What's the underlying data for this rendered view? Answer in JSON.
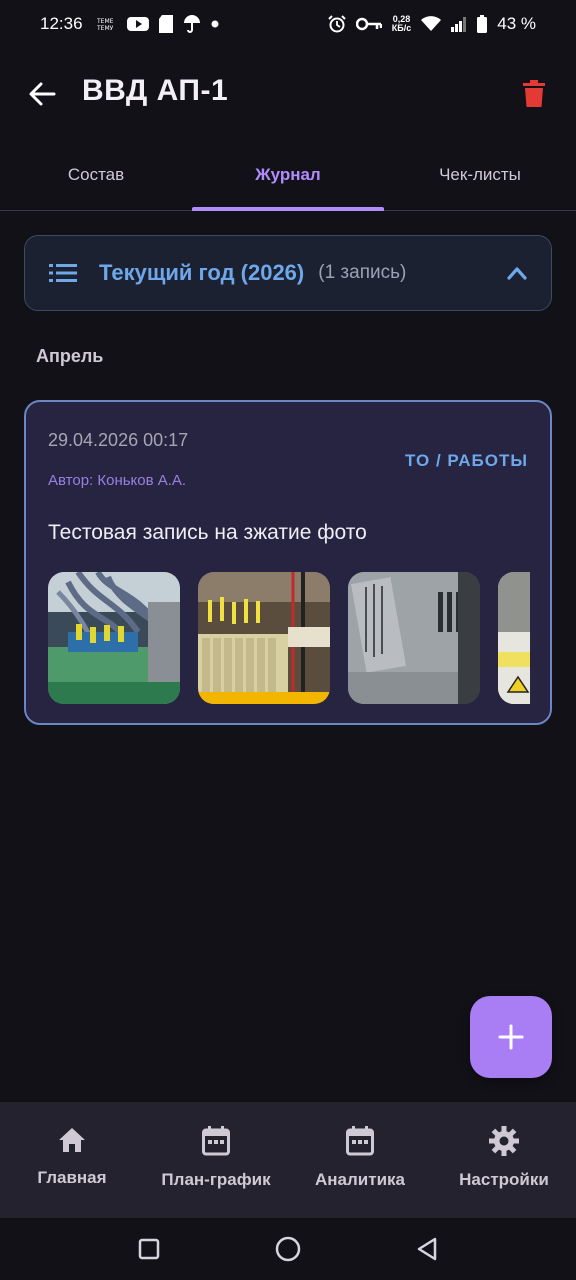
{
  "status_bar": {
    "time": "12:36",
    "net_speed_top": "0,28",
    "net_speed_bottom": "КБ/с",
    "battery": "43 %"
  },
  "app_bar": {
    "title": "ВВД АП-1",
    "back_icon": "arrow-left-icon",
    "delete_icon": "trash-icon",
    "delete_color": "#e53935"
  },
  "tabs": [
    {
      "label": "Состав",
      "active": false
    },
    {
      "label": "Журнал",
      "active": true
    },
    {
      "label": "Чек-листы",
      "active": false
    }
  ],
  "year_group": {
    "title": "Текущий год (2026)",
    "count": "(1 запись)",
    "expanded": true
  },
  "month": "Апрель",
  "entry": {
    "datetime": "29.04.2026 00:17",
    "author": "Автор: Коньков А.А.",
    "type": "ТО / РАБОТЫ",
    "text": "Тестовая запись на зжатие фото",
    "photos": [
      "photo-1",
      "photo-2",
      "photo-3",
      "photo-4"
    ]
  },
  "fab": {
    "icon": "plus-icon",
    "color": "#a97ef5"
  },
  "bottom_nav": [
    {
      "label": "Главная",
      "icon": "home-icon"
    },
    {
      "label": "План-график",
      "icon": "calendar-icon"
    },
    {
      "label": "Аналитика",
      "icon": "calendar-icon"
    },
    {
      "label": "Настройки",
      "icon": "gear-icon"
    }
  ],
  "colors": {
    "accent": "#b18cff",
    "link_blue": "#6ea7ea",
    "background": "#121118"
  }
}
